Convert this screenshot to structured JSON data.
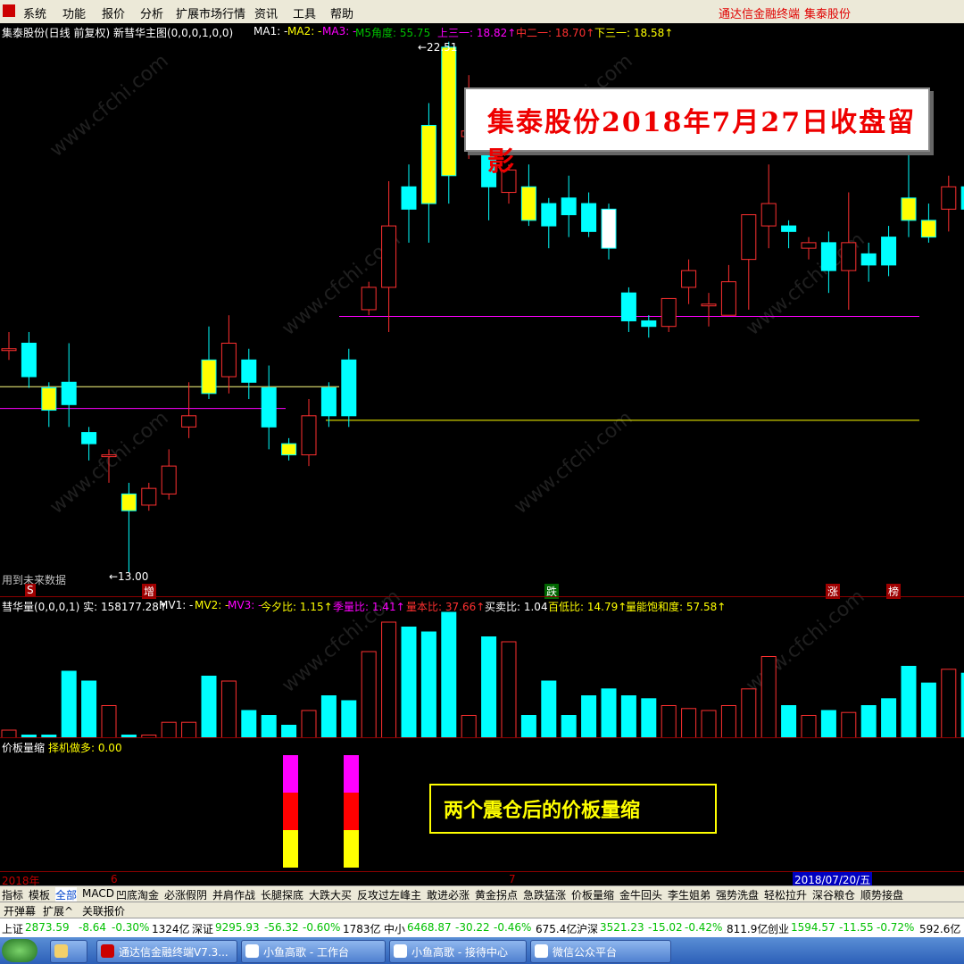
{
  "menu": {
    "items": [
      "系统",
      "功能",
      "报价",
      "分析",
      "扩展市场行情",
      "资讯",
      "工具",
      "帮助"
    ],
    "brand": "通达信金融终端",
    "stock": "集泰股份"
  },
  "main_panel": {
    "title": "集泰股份(日线 前复权) 新彗华主图(0,0,0,1,0,0)",
    "ma1": "MA1: -",
    "ma2": "MA2: -",
    "ma3": "MA3: -",
    "m5": "M5角度: 55.75",
    "up3": "上三一: 18.82↑",
    "mid2": "中二一: 18.70↑",
    "down3": "下三一: 18.58↑",
    "high_label": "←22.51",
    "low_label": "←13.00",
    "future_label": "用到未来数据",
    "banner": "集泰股份2018年7月27日收盘留影",
    "markers": [
      "S",
      "增",
      "跌",
      "涨",
      "榜"
    ]
  },
  "volume_panel": {
    "title": "彗华量(0,0,0,1) 实: 158177.28↑",
    "mv1": "MV1: -",
    "mv2": "MV2: -",
    "mv3": "MV3: -",
    "jinxi": "今夕比: 1.15↑",
    "jiliang": "季量比: 1.41↑",
    "liangben": "量本比: 37.66↑",
    "maimai": "买卖比: 1.04",
    "baidi": "百低比: 14.79↑",
    "liangneng": "量能饱和度: 57.58↑"
  },
  "price_board_panel": {
    "title": "价板量缩",
    "value": "择机做多: 0.00",
    "note": "两个震仓后的价板量缩"
  },
  "date_axis": {
    "year": "2018年",
    "month6": "6",
    "month7": "7",
    "selected_date": "2018/07/20/五"
  },
  "tabs": [
    "指标",
    "模板",
    "全部",
    "MACD",
    "凹底淘金",
    "必涨假阴",
    "并肩作战",
    "长腿探底",
    "大跌大买",
    "反攻过左峰主",
    "敢进必涨",
    "黄金拐点",
    "急跌猛涨",
    "价板量缩",
    "金牛回头",
    "李生姐弟",
    "强势洗盘",
    "轻松拉升",
    "深谷粮仓",
    "顺势接盘"
  ],
  "active_tab": "全部",
  "tabs2": [
    "开弹幕",
    "扩展^",
    "关联报价"
  ],
  "status": {
    "sh_label": "上证",
    "sh_val": "2873.59",
    "sh_chg": "-8.64",
    "sh_pct": "-0.30%",
    "sh_amt": "1324亿",
    "sz_label": "深证",
    "sz_val": "9295.93",
    "sz_chg": "-56.32",
    "sz_pct": "-0.60%",
    "sz_amt": "1783亿",
    "zx_label": "中小",
    "zx_val": "6468.87",
    "zx_chg": "-30.22",
    "zx_pct": "-0.46%",
    "zx_amt": "675.4亿",
    "hs_label": "沪深",
    "hs_val": "3521.23",
    "hs_chg": "-15.02",
    "hs_pct": "-0.42%",
    "hs_amt": "811.9亿",
    "cy_label": "创业",
    "cy_val": "1594.57",
    "cy_chg": "-11.55",
    "cy_pct": "-0.72%",
    "cy_amt": "592.6亿"
  },
  "taskbar": {
    "tasks": [
      "通达信金融终端V7.3...",
      "小鱼高歌 - 工作台",
      "小鱼高歌 - 接待中心",
      "微信公众平台"
    ]
  },
  "watermark": "www.cfchi.com",
  "chart_data": {
    "type": "candlestick",
    "price_range": [
      13.0,
      22.51
    ],
    "reference_lines": {
      "magenta_low": 15.93,
      "yellow_low": 15.72,
      "yellow_mid": 16.32,
      "magenta_high": 17.58
    },
    "candles": [
      {
        "o": 17.0,
        "c": 17.0,
        "h": 17.3,
        "l": 16.8
      },
      {
        "o": 17.1,
        "c": 16.5,
        "h": 17.3,
        "l": 16.3
      },
      {
        "o": 16.3,
        "c": 15.9,
        "h": 16.4,
        "l": 15.6
      },
      {
        "o": 16.4,
        "c": 16.0,
        "h": 17.1,
        "l": 15.6
      },
      {
        "o": 15.5,
        "c": 15.3,
        "h": 15.6,
        "l": 15.0
      },
      {
        "o": 15.1,
        "c": 15.1,
        "h": 15.2,
        "l": 14.6
      },
      {
        "o": 14.4,
        "c": 14.1,
        "h": 14.6,
        "l": 13.0
      },
      {
        "o": 14.2,
        "c": 14.5,
        "h": 14.6,
        "l": 14.1
      },
      {
        "o": 14.4,
        "c": 14.9,
        "h": 15.2,
        "l": 14.3
      },
      {
        "o": 15.6,
        "c": 15.8,
        "h": 16.4,
        "l": 15.4
      },
      {
        "o": 16.8,
        "c": 16.2,
        "h": 17.4,
        "l": 16.1
      },
      {
        "o": 16.5,
        "c": 17.1,
        "h": 17.6,
        "l": 16.2
      },
      {
        "o": 16.8,
        "c": 16.4,
        "h": 17.0,
        "l": 16.1
      },
      {
        "o": 16.3,
        "c": 15.6,
        "h": 16.7,
        "l": 15.2
      },
      {
        "o": 15.3,
        "c": 15.1,
        "h": 15.4,
        "l": 15.0
      },
      {
        "o": 15.1,
        "c": 15.8,
        "h": 16.1,
        "l": 14.9
      },
      {
        "o": 16.3,
        "c": 15.8,
        "h": 16.4,
        "l": 15.6
      },
      {
        "o": 16.8,
        "c": 15.8,
        "h": 17.0,
        "l": 15.6
      },
      {
        "o": 17.7,
        "c": 18.1,
        "h": 18.2,
        "l": 17.6
      },
      {
        "o": 18.1,
        "c": 19.2,
        "h": 20.0,
        "l": 17.3
      },
      {
        "o": 19.9,
        "c": 19.5,
        "h": 20.3,
        "l": 18.9
      },
      {
        "o": 21.0,
        "c": 19.6,
        "h": 21.4,
        "l": 18.9
      },
      {
        "o": 22.4,
        "c": 20.1,
        "h": 22.5,
        "l": 19.6
      },
      {
        "o": 20.8,
        "c": 20.9,
        "h": 21.9,
        "l": 20.4
      },
      {
        "o": 21.0,
        "c": 19.9,
        "h": 21.2,
        "l": 19.3
      },
      {
        "o": 19.8,
        "c": 20.2,
        "h": 20.3,
        "l": 19.6
      },
      {
        "o": 19.9,
        "c": 19.3,
        "h": 20.3,
        "l": 19.2
      },
      {
        "o": 19.6,
        "c": 19.2,
        "h": 19.7,
        "l": 18.8
      },
      {
        "o": 19.7,
        "c": 19.4,
        "h": 20.1,
        "l": 19.0
      },
      {
        "o": 19.6,
        "c": 19.1,
        "h": 19.8,
        "l": 19.0
      },
      {
        "o": 19.5,
        "c": 18.8,
        "h": 19.6,
        "l": 18.6
      },
      {
        "o": 18.0,
        "c": 17.5,
        "h": 18.1,
        "l": 17.3
      },
      {
        "o": 17.5,
        "c": 17.4,
        "h": 17.6,
        "l": 17.2
      },
      {
        "o": 17.4,
        "c": 17.9,
        "h": 17.9,
        "l": 17.3
      },
      {
        "o": 18.1,
        "c": 18.4,
        "h": 18.6,
        "l": 17.8
      },
      {
        "o": 17.8,
        "c": 17.8,
        "h": 18.0,
        "l": 17.4
      },
      {
        "o": 17.6,
        "c": 18.2,
        "h": 18.5,
        "l": 17.6
      },
      {
        "o": 18.6,
        "c": 19.4,
        "h": 19.4,
        "l": 17.7
      },
      {
        "o": 19.2,
        "c": 19.6,
        "h": 20.3,
        "l": 18.8
      },
      {
        "o": 19.2,
        "c": 19.1,
        "h": 19.3,
        "l": 18.8
      },
      {
        "o": 18.8,
        "c": 18.9,
        "h": 19.0,
        "l": 18.6
      },
      {
        "o": 18.9,
        "c": 18.4,
        "h": 19.1,
        "l": 18.0
      },
      {
        "o": 18.4,
        "c": 18.9,
        "h": 19.8,
        "l": 17.7
      },
      {
        "o": 18.7,
        "c": 18.5,
        "h": 18.9,
        "l": 18.2
      },
      {
        "o": 19.0,
        "c": 18.5,
        "h": 19.2,
        "l": 18.3
      },
      {
        "o": 19.7,
        "c": 19.3,
        "h": 21.1,
        "l": 19.0
      },
      {
        "o": 19.3,
        "c": 19.0,
        "h": 19.6,
        "l": 18.9
      },
      {
        "o": 19.5,
        "c": 19.9,
        "h": 20.1,
        "l": 19.1
      },
      {
        "o": 19.9,
        "c": 19.5,
        "h": 20.1,
        "l": 17.6
      }
    ]
  }
}
